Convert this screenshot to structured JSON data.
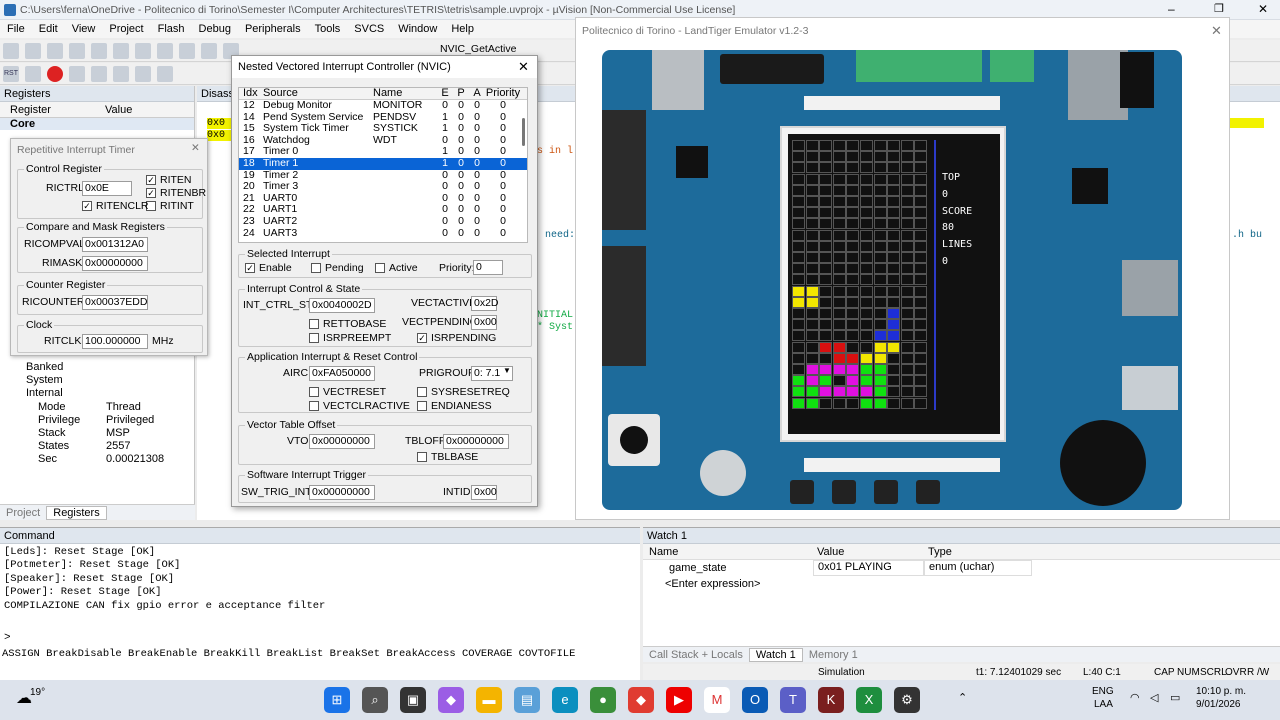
{
  "window": {
    "title": "C:\\Users\\ferna\\OneDrive - Politecnico di Torino\\Semester I\\Computer Architectures\\TETRIS\\tetris\\sample.uvprojx - µVision  [Non-Commercial Use License]"
  },
  "menu": [
    "File",
    "Edit",
    "View",
    "Project",
    "Flash",
    "Debug",
    "Peripherals",
    "Tools",
    "SVCS",
    "Window",
    "Help"
  ],
  "toolbar": {
    "nvic_label": "NVIC_GetActive",
    "rst": "RST"
  },
  "registers": {
    "title": "Registers",
    "col_register": "Register",
    "col_value": "Value",
    "core": "Core",
    "tree": [
      {
        "name": "Banked"
      },
      {
        "name": "System"
      },
      {
        "name": "Internal"
      }
    ],
    "internal": [
      {
        "k": "Mode",
        "v": "Thread"
      },
      {
        "k": "Privilege",
        "v": "Privileged"
      },
      {
        "k": "Stack",
        "v": "MSP"
      },
      {
        "k": "States",
        "v": "2557"
      },
      {
        "k": "Sec",
        "v": "0.00021308"
      }
    ],
    "tab_project": "Project",
    "tab_registers": "Registers"
  },
  "rit": {
    "title": "Repetitive Interrupt Timer",
    "control": "Control Register",
    "rictrl_label": "RICTRL:",
    "rictrl": "0x0E",
    "riten": "RITEN",
    "ritenbr": "RITENBR",
    "ritint": "RITINT",
    "ritenclr": "RITENCLR",
    "compare": "Compare and Mask Registers",
    "ricompval_label": "RICOMPVAL:",
    "ricompval": "0x001312A0",
    "rimask_label": "RIMASK:",
    "rimask": "0x00000000",
    "counter": "Counter Register",
    "ricounter_label": "RICOUNTER:",
    "ricounter": "0x00037EDD",
    "clock": "Clock",
    "ritclk_label": "RITCLK:",
    "ritclk": "100.000000",
    "mhz": "MHz"
  },
  "disasm": {
    "tab": "Disasse",
    "lines": [
      "0x0",
      "0x0"
    ],
    "code": [
      "s in l",
      "need:",
      "NITIAL",
      "* Syst",
      ".h bu"
    ]
  },
  "nvic": {
    "title": "Nested Vectored Interrupt Controller (NVIC)",
    "headers": [
      "Idx",
      "Source",
      "Name",
      "E",
      "P",
      "A",
      "Priority"
    ],
    "rows": [
      {
        "idx": "12",
        "src": "Debug Monitor",
        "name": "MONITOR",
        "e": "0",
        "p": "0",
        "a": "0",
        "pr": "0"
      },
      {
        "idx": "14",
        "src": "Pend System Service",
        "name": "PENDSV",
        "e": "1",
        "p": "0",
        "a": "0",
        "pr": "0"
      },
      {
        "idx": "15",
        "src": "System Tick Timer",
        "name": "SYSTICK",
        "e": "1",
        "p": "0",
        "a": "0",
        "pr": "0"
      },
      {
        "idx": "16",
        "src": "Watchdog",
        "name": "WDT",
        "e": "0",
        "p": "0",
        "a": "0",
        "pr": "0"
      },
      {
        "idx": "17",
        "src": "Timer 0",
        "name": "",
        "e": "1",
        "p": "0",
        "a": "0",
        "pr": "0"
      },
      {
        "idx": "18",
        "src": "Timer 1",
        "name": "",
        "e": "1",
        "p": "0",
        "a": "0",
        "pr": "0"
      },
      {
        "idx": "19",
        "src": "Timer 2",
        "name": "",
        "e": "0",
        "p": "0",
        "a": "0",
        "pr": "0"
      },
      {
        "idx": "20",
        "src": "Timer 3",
        "name": "",
        "e": "0",
        "p": "0",
        "a": "0",
        "pr": "0"
      },
      {
        "idx": "21",
        "src": "UART0",
        "name": "",
        "e": "0",
        "p": "0",
        "a": "0",
        "pr": "0"
      },
      {
        "idx": "22",
        "src": "UART1",
        "name": "",
        "e": "0",
        "p": "0",
        "a": "0",
        "pr": "0"
      },
      {
        "idx": "23",
        "src": "UART2",
        "name": "",
        "e": "0",
        "p": "0",
        "a": "0",
        "pr": "0"
      },
      {
        "idx": "24",
        "src": "UART3",
        "name": "",
        "e": "0",
        "p": "0",
        "a": "0",
        "pr": "0"
      }
    ],
    "selected_group": "Selected Interrupt",
    "enable": "Enable",
    "pending": "Pending",
    "active": "Active",
    "priority_label": "Priority:",
    "priority": "0",
    "ics_group": "Interrupt Control & State",
    "int_ctrl_st_label": "INT_CTRL_ST:",
    "int_ctrl_st": "0x0040002D",
    "vectactive_label": "VECTACTIVE:",
    "vectactive": "0x2D",
    "vectpending_label": "VECTPENDING:",
    "vectpending": "0x00",
    "rettobase": "RETTOBASE",
    "isrpreempt": "ISRPREEMPT",
    "isrpending": "ISRPENDING",
    "airc_group": "Application Interrupt & Reset Control",
    "airc_label": "AIRC:",
    "airc": "0xFA050000",
    "prigroup_label": "PRIGROUP:",
    "prigroup": "0: 7.1",
    "vectreset": "VECTRESET",
    "sysresetreq": "SYSRESETREQ",
    "vectclractive": "VECTCLRACTIVE",
    "endianess": "ENDIANESS",
    "vto_group": "Vector Table Offset",
    "vto_label": "VTO:",
    "vto": "0x00000000",
    "tbloff_label": "TBLOFF:",
    "tbloff": "0x00000000",
    "tblbase": "TBLBASE",
    "swi_group": "Software Interrupt Trigger",
    "swtrig_label": "SW_TRIG_INT:",
    "swtrig": "0x00000000",
    "intid_label": "INTID:",
    "intid": "0x00"
  },
  "emulator": {
    "title": "Politecnico di Torino - LandTiger Emulator v1.2-3",
    "lcd": {
      "top_label": "TOP",
      "top": "0",
      "score_label": "SCORE",
      "score": "80",
      "lines_label": "LINES",
      "lines": "0"
    },
    "colors": {
      "board": "#1d6b9b",
      "yellow": "#f2e600",
      "blue": "#1e2ed8",
      "red": "#d81010",
      "magenta": "#e010e0",
      "green": "#10e010"
    }
  },
  "command": {
    "title": "Command",
    "lines": [
      "[Leds]: Reset Stage [OK]",
      "[Potmeter]: Reset Stage [OK]",
      "[Speaker]: Reset Stage [OK]",
      "[Power]: Reset Stage [OK]",
      "COMPILAZIONE CAN fix gpio error e acceptance filter"
    ],
    "prompt": ">",
    "hint": "ASSIGN BreakDisable BreakEnable BreakKill BreakList BreakSet BreakAccess COVERAGE COVTOFILE"
  },
  "watch": {
    "title": "Watch 1",
    "col_name": "Name",
    "col_value": "Value",
    "col_type": "Type",
    "rows": [
      {
        "name": "game_state",
        "value": "0x01 PLAYING",
        "type": "enum (uchar)"
      },
      {
        "name": "<Enter expression>",
        "value": "",
        "type": ""
      }
    ],
    "tabs": [
      "Call Stack + Locals",
      "Watch 1",
      "Memory 1"
    ]
  },
  "status": {
    "sim": "Simulation",
    "time": "t1: 7.12401029 sec",
    "pos": "L:40 C:1",
    "flags": [
      "CAP",
      "NUM",
      "SCRL",
      "OVR",
      "R /W"
    ]
  },
  "taskbar": {
    "weather": "19°",
    "lang": "ENG",
    "layout": "LAA",
    "time": "10:10 p. m.",
    "date": "9/01/2026"
  }
}
